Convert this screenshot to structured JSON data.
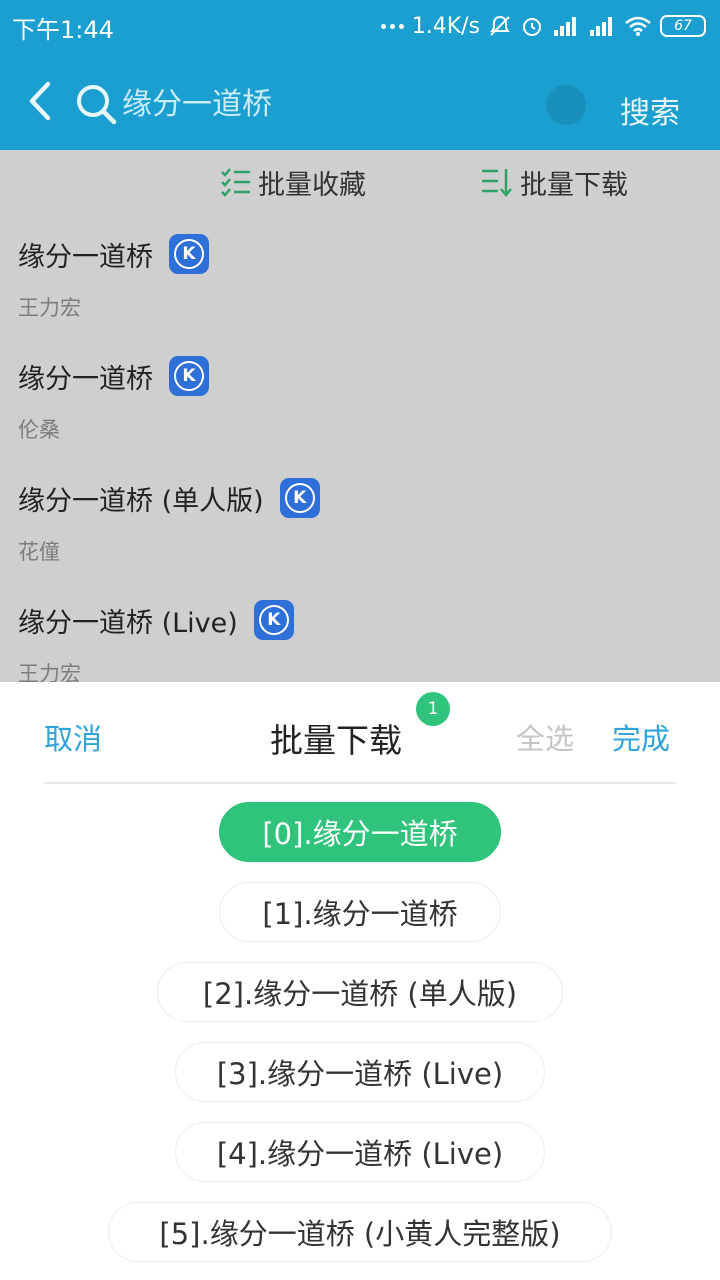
{
  "status_bar": {
    "time": "下午1:44",
    "network_speed": "1.4K/s",
    "battery": "67"
  },
  "header": {
    "search_value": "缘分一道桥",
    "search_button": "搜索"
  },
  "toolbar": {
    "batch_favorite": "批量收藏",
    "batch_download": "批量下载"
  },
  "songs": [
    {
      "title": "缘分一道桥",
      "artist": "王力宏",
      "badge": "K"
    },
    {
      "title": "缘分一道桥",
      "artist": "伦桑",
      "badge": "K"
    },
    {
      "title": "缘分一道桥 (单人版)",
      "artist": "花僮",
      "badge": "K"
    },
    {
      "title": "缘分一道桥 (Live)",
      "artist": "王力宏",
      "badge": "K"
    }
  ],
  "sheet": {
    "cancel": "取消",
    "title": "批量下载",
    "selected_count": "1",
    "select_all": "全选",
    "done": "完成",
    "items": [
      {
        "label": "[0].缘分一道桥",
        "selected": true
      },
      {
        "label": "[1].缘分一道桥",
        "selected": false
      },
      {
        "label": "[2].缘分一道桥 (单人版)",
        "selected": false
      },
      {
        "label": "[3].缘分一道桥 (Live)",
        "selected": false
      },
      {
        "label": "[4].缘分一道桥 (Live)",
        "selected": false
      },
      {
        "label": "[5].缘分一道桥 (小黄人完整版)",
        "selected": false
      }
    ]
  },
  "colors": {
    "header_bg": "#1a9fd0",
    "accent_blue": "#2ea3dc",
    "selected_green": "#2fc37b",
    "k_badge": "#2f6fd8"
  }
}
